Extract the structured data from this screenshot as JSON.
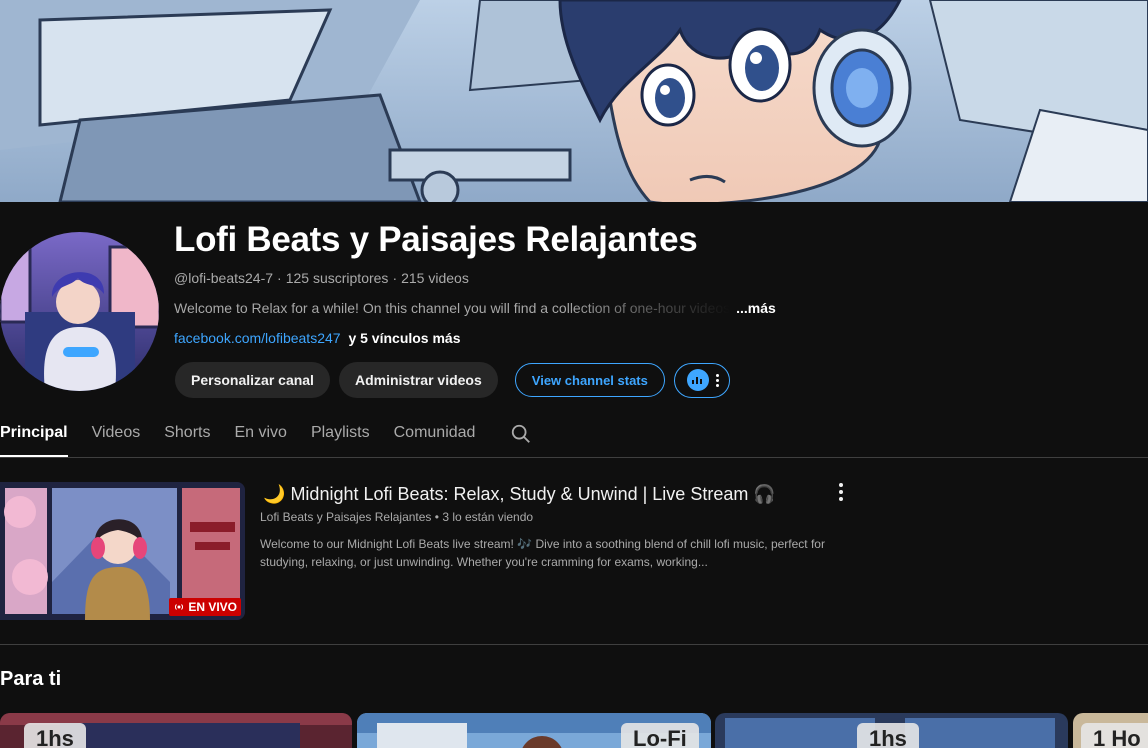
{
  "channel": {
    "name": "Lofi Beats y Paisajes Relajantes",
    "handle": "@lofi-beats24-7",
    "separator": "·",
    "subscribers": "125 suscriptores",
    "videos": "215 videos",
    "description": "Welcome to Relax for a while! On this channel you will find a collection of one-hour videos",
    "more_label": "...más",
    "link": "facebook.com/lofibeats247",
    "more_links": "y 5 vínculos más"
  },
  "actions": {
    "customize": "Personalizar canal",
    "manage_videos": "Administrar videos",
    "stats": "View channel stats"
  },
  "tabs": [
    {
      "label": "Principal",
      "active": true
    },
    {
      "label": "Videos"
    },
    {
      "label": "Shorts"
    },
    {
      "label": "En vivo"
    },
    {
      "label": "Playlists"
    },
    {
      "label": "Comunidad"
    }
  ],
  "featured": {
    "title_emoji": "🌙",
    "title": "Midnight Lofi Beats: Relax, Study & Unwind | Live Stream",
    "title_end_emoji": "🎧",
    "channel": "Lofi Beats y Paisajes Relajantes",
    "viewers": "3 lo están viendo",
    "description": "Welcome to our Midnight Lofi Beats live stream! 🎶 Dive into a soothing blend of chill lofi music, perfect for studying, relaxing, or just unwinding. Whether you're cramming for exams, working...",
    "live_badge": "EN VIVO"
  },
  "section": {
    "title": "Para ti",
    "thumbs": [
      {
        "label": "1hs"
      },
      {
        "label": "Lo-Fi"
      },
      {
        "label": "1hs"
      },
      {
        "label": "1 Ho"
      }
    ]
  },
  "colors": {
    "background": "#0f0f0f",
    "accent": "#3ea6ff",
    "live": "#cc0000",
    "button": "#272727"
  },
  "icons": {
    "search": "search-icon",
    "kebab": "more-vert-icon",
    "stats": "stats-icon",
    "live": "live-broadcast-icon",
    "moon": "moon-emoji",
    "headphones": "headphones-emoji"
  }
}
